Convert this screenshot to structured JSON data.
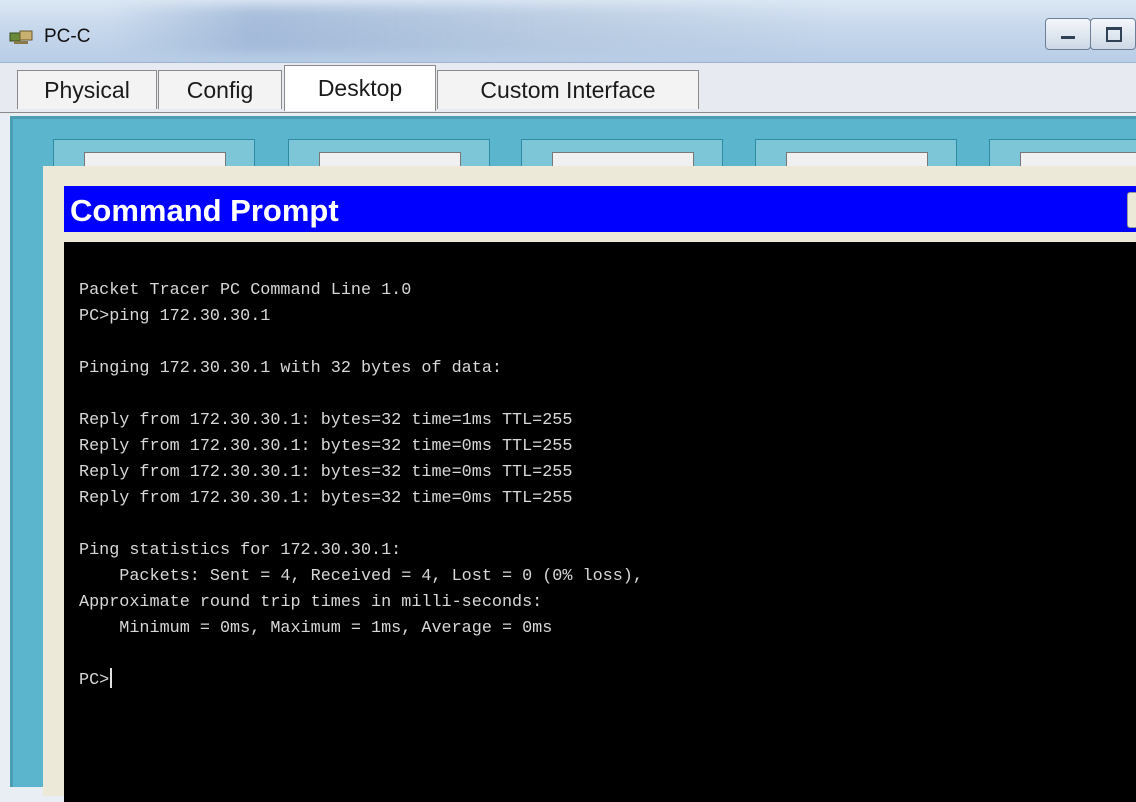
{
  "window": {
    "title": "PC-C",
    "icon": "packet-tracer-pc-icon",
    "controls": [
      "minimize-icon",
      "maximize-icon"
    ]
  },
  "tabs": [
    {
      "label": "Physical",
      "active": false
    },
    {
      "label": "Config",
      "active": false
    },
    {
      "label": "Desktop",
      "active": true
    },
    {
      "label": "Custom Interface",
      "active": false
    }
  ],
  "command_prompt": {
    "title": "Command Prompt",
    "lines": [
      "Packet Tracer PC Command Line 1.0",
      "PC>ping 172.30.30.1",
      "",
      "Pinging 172.30.30.1 with 32 bytes of data:",
      "",
      "Reply from 172.30.30.1: bytes=32 time=1ms TTL=255",
      "Reply from 172.30.30.1: bytes=32 time=0ms TTL=255",
      "Reply from 172.30.30.1: bytes=32 time=0ms TTL=255",
      "Reply from 172.30.30.1: bytes=32 time=0ms TTL=255",
      "",
      "Ping statistics for 172.30.30.1:",
      "    Packets: Sent = 4, Received = 4, Lost = 0 (0% loss),",
      "Approximate round trip times in milli-seconds:",
      "    Minimum = 0ms, Maximum = 1ms, Average = 0ms",
      ""
    ],
    "prompt": "PC>"
  },
  "colors": {
    "desktop_bg": "#5bb6cd",
    "cmd_titlebar": "#0000ff",
    "terminal_bg": "#000000",
    "terminal_text": "#d8d8d8"
  }
}
